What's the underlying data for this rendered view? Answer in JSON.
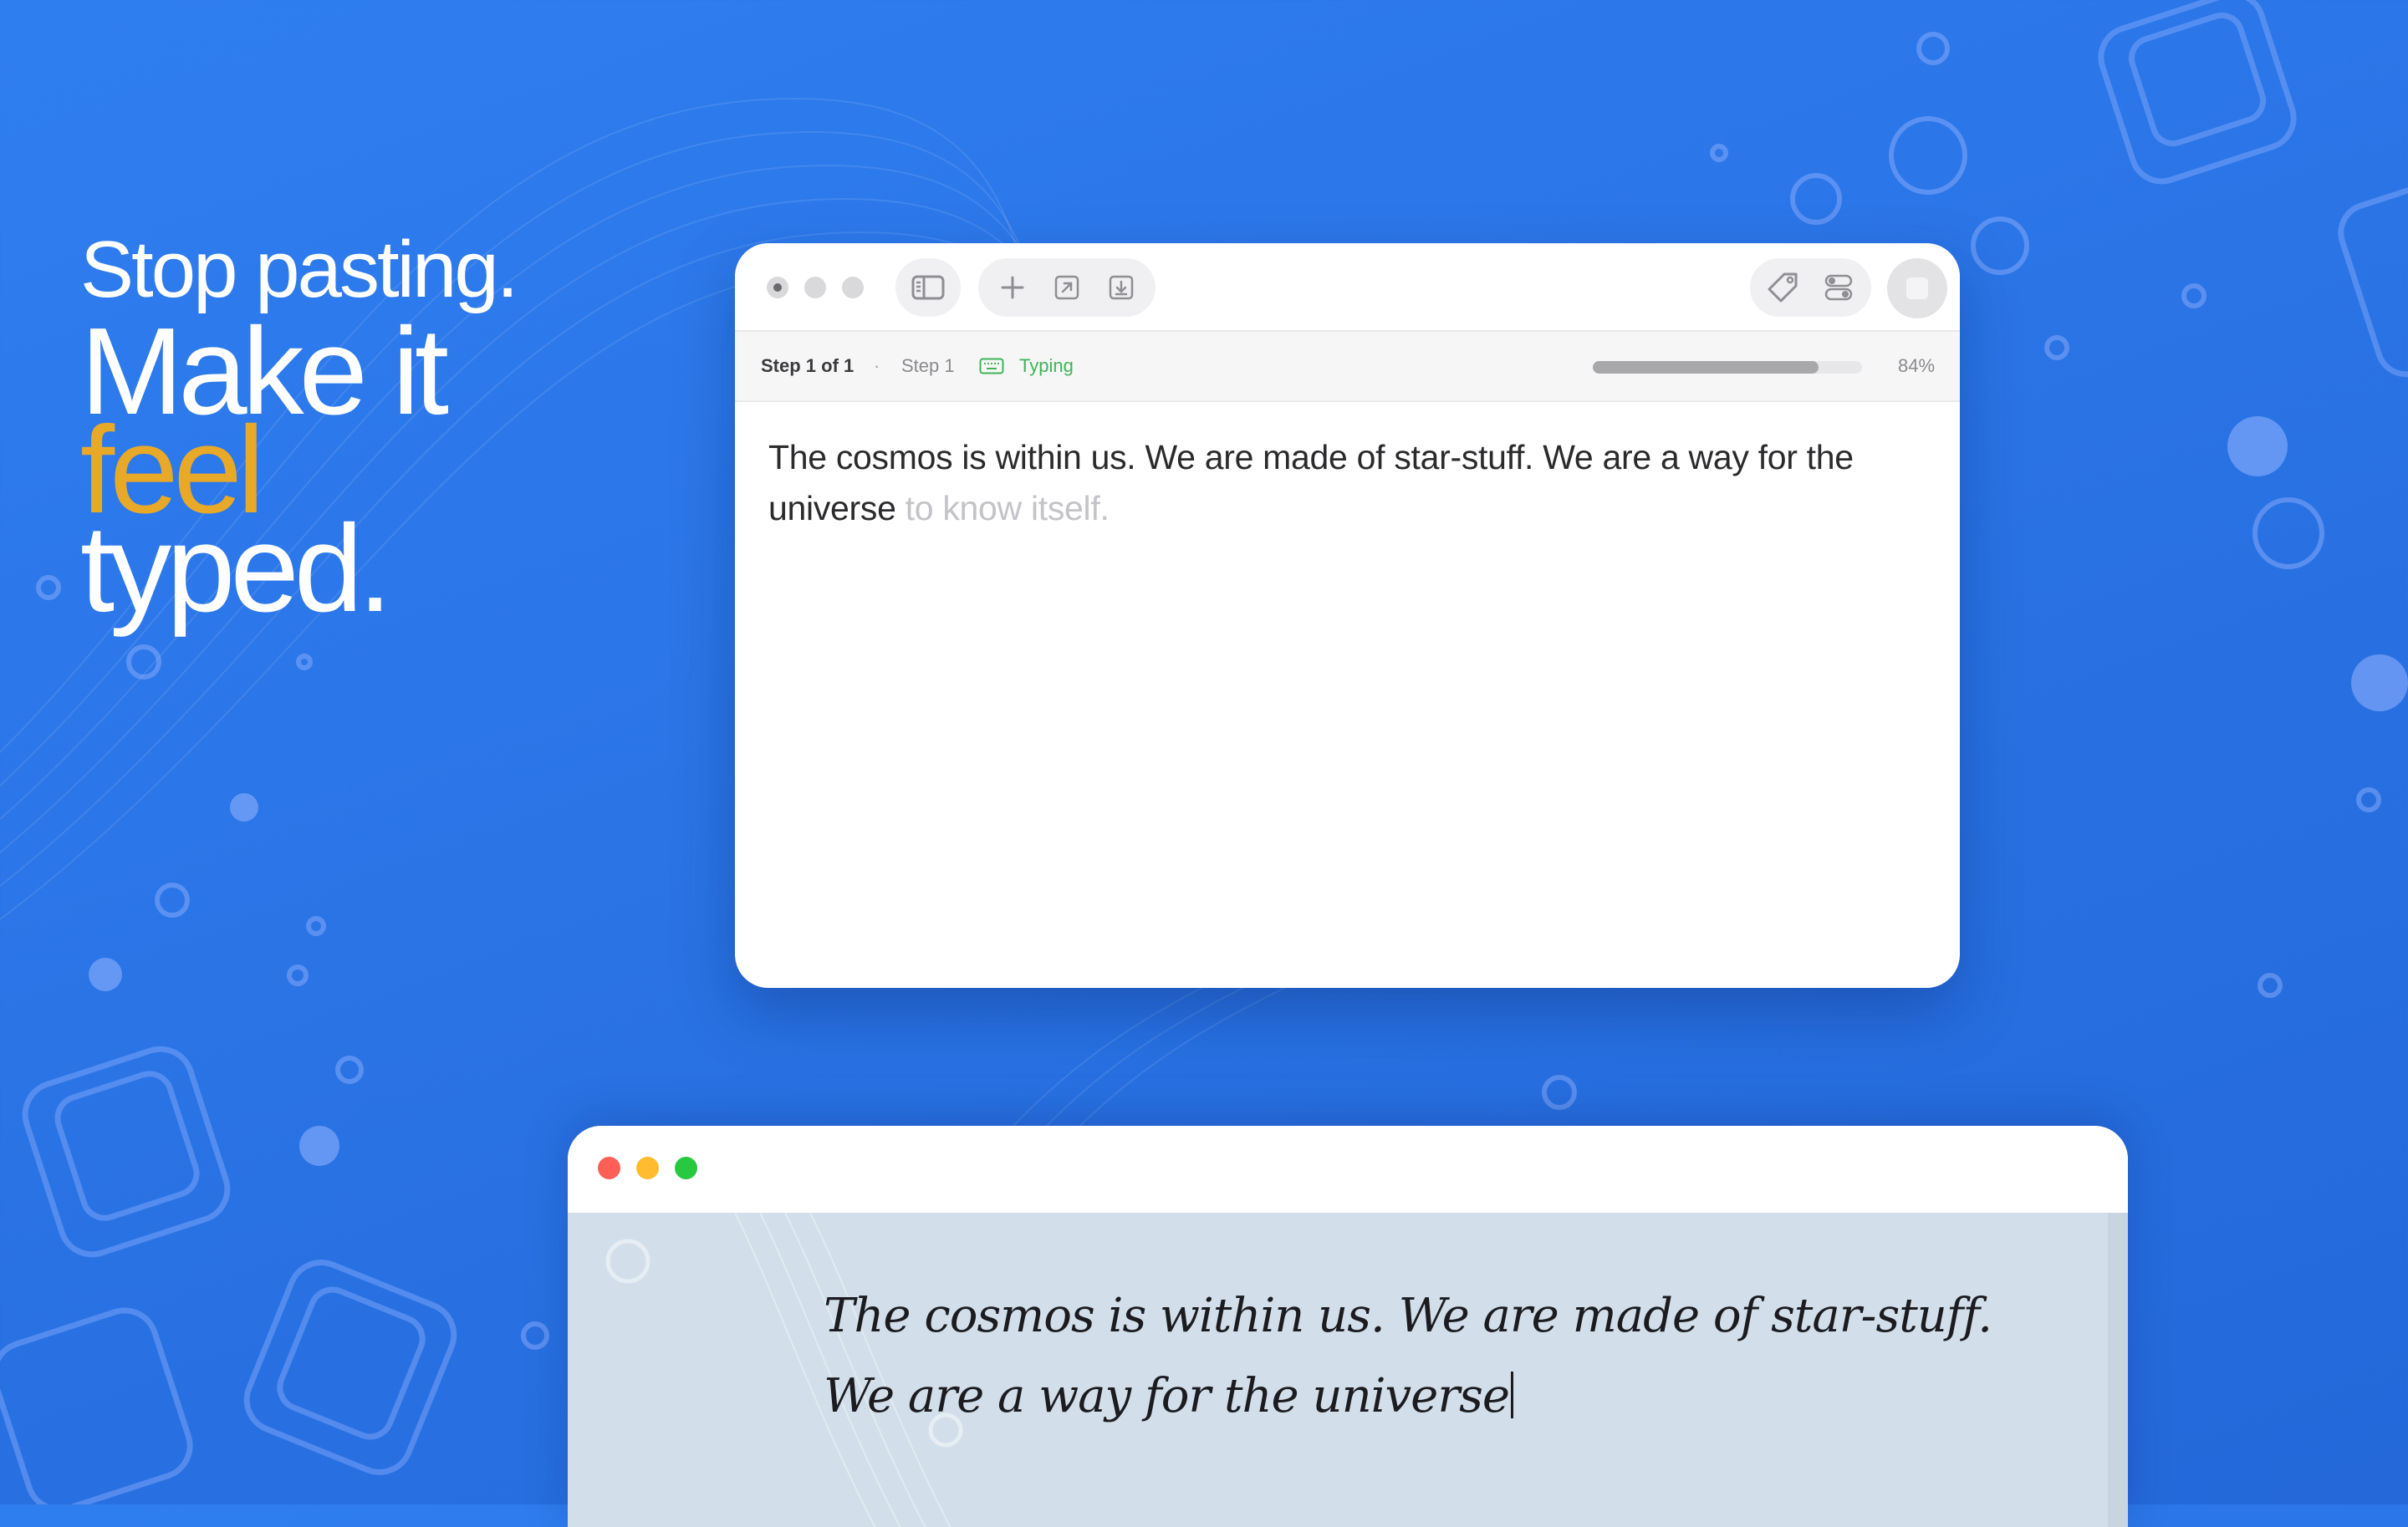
{
  "headline": {
    "line1": "Stop pasting.",
    "line2": "Make it",
    "line3_accent": "feel",
    "line4": "typed.",
    "accent_color": "#e8a928"
  },
  "app_window": {
    "toolbar": {
      "traffic_lights": [
        "close",
        "minimize",
        "zoom"
      ],
      "sidebar_toggle_icon": "sidebar-icon",
      "actions_icons": [
        "plus-icon",
        "open-external-icon",
        "download-icon"
      ],
      "right_icons": [
        "tag-icon",
        "toggles-icon"
      ],
      "stop_icon": "stop-icon"
    },
    "status": {
      "step_counter": "Step 1 of 1",
      "separator": "·",
      "step_name": "Step 1",
      "keyboard_icon": "keyboard-icon",
      "state": "Typing",
      "progress_percent": 84,
      "progress_label": "84%"
    },
    "editor": {
      "typed_text": "The cosmos is within us. We are made of star-stuff. We are a way for the universe",
      "remaining_text": " to know itself."
    }
  },
  "browser_window": {
    "traffic_lights": [
      "red",
      "yellow",
      "green"
    ],
    "line1": "The cosmos is within us. We are made of star-stuff.",
    "line2": "We are a way for the universe"
  }
}
